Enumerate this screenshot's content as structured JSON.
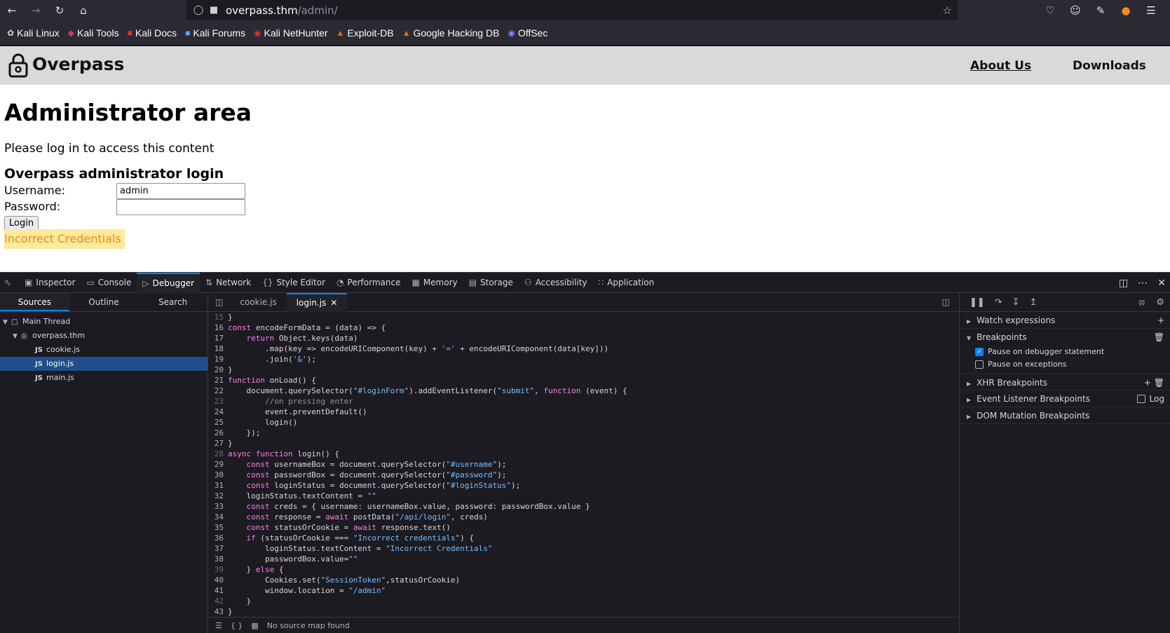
{
  "browser": {
    "url_host": "overpass.thm",
    "url_path": "/admin/"
  },
  "bookmarks": [
    "Kali Linux",
    "Kali Tools",
    "Kali Docs",
    "Kali Forums",
    "Kali NetHunter",
    "Exploit-DB",
    "Google Hacking DB",
    "OffSec"
  ],
  "site": {
    "name": "Overpass",
    "nav": {
      "about": "About Us",
      "downloads": "Downloads"
    },
    "title": "Administrator area",
    "description": "Please log in to access this content",
    "login_heading": "Overpass administrator login",
    "username_label": "Username:",
    "password_label": "Password:",
    "username_value": "admin",
    "password_value": "",
    "login_button": "Login",
    "status": "Incorrect Credentials"
  },
  "devtools": {
    "tabs": [
      "Inspector",
      "Console",
      "Debugger",
      "Network",
      "Style Editor",
      "Performance",
      "Memory",
      "Storage",
      "Accessibility",
      "Application"
    ],
    "active_tab": "Debugger",
    "source_tabs": [
      "Sources",
      "Outline",
      "Search"
    ],
    "tree": {
      "thread": "Main Thread",
      "host": "overpass.thm",
      "files": [
        "cookie.js",
        "login.js",
        "main.js"
      ],
      "selected": "login.js"
    },
    "editor_tabs": [
      "cookie.js",
      "login.js"
    ],
    "code_lines": [
      {
        "n": "15",
        "t": "}"
      },
      {
        "n": "16",
        "t": "const encodeFormData = (data) => {"
      },
      {
        "n": "17",
        "t": "    return Object.keys(data)"
      },
      {
        "n": "18",
        "t": "        .map(key => encodeURIComponent(key) + '=' + encodeURIComponent(data[key]))"
      },
      {
        "n": "19",
        "t": "        .join('&');"
      },
      {
        "n": "20",
        "t": "}"
      },
      {
        "n": "21",
        "t": "function onLoad() {"
      },
      {
        "n": "22",
        "t": "    document.querySelector(\"#loginForm\").addEventListener(\"submit\", function (event) {"
      },
      {
        "n": "23",
        "t": "        //on pressing enter"
      },
      {
        "n": "24",
        "t": "        event.preventDefault()"
      },
      {
        "n": "25",
        "t": "        login()"
      },
      {
        "n": "26",
        "t": "    });"
      },
      {
        "n": "27",
        "t": "}"
      },
      {
        "n": "28",
        "t": "async function login() {"
      },
      {
        "n": "29",
        "t": "    const usernameBox = document.querySelector(\"#username\");"
      },
      {
        "n": "30",
        "t": "    const passwordBox = document.querySelector(\"#password\");"
      },
      {
        "n": "31",
        "t": "    const loginStatus = document.querySelector(\"#loginStatus\");"
      },
      {
        "n": "32",
        "t": "    loginStatus.textContent = \"\""
      },
      {
        "n": "33",
        "t": "    const creds = { username: usernameBox.value, password: passwordBox.value }"
      },
      {
        "n": "34",
        "t": "    const response = await postData(\"/api/login\", creds)"
      },
      {
        "n": "35",
        "t": "    const statusOrCookie = await response.text()"
      },
      {
        "n": "36",
        "t": "    if (statusOrCookie === \"Incorrect credentials\") {"
      },
      {
        "n": "37",
        "t": "        loginStatus.textContent = \"Incorrect Credentials\""
      },
      {
        "n": "38",
        "t": "        passwordBox.value=\"\""
      },
      {
        "n": "39",
        "t": "    } else {"
      },
      {
        "n": "40",
        "t": "        Cookies.set(\"SessionToken\",statusOrCookie)"
      },
      {
        "n": "41",
        "t": "        window.location = \"/admin\""
      },
      {
        "n": "42",
        "t": "    }"
      },
      {
        "n": "43",
        "t": "}"
      }
    ],
    "muted_lines": [
      "15",
      "23",
      "28",
      "39",
      "42"
    ],
    "status_text": "No source map found",
    "side_panel": {
      "watch": "Watch expressions",
      "breakpoints": "Breakpoints",
      "pause_debugger": "Pause on debugger statement",
      "pause_exceptions": "Pause on exceptions",
      "xhr": "XHR Breakpoints",
      "event_listener": "Event Listener Breakpoints",
      "log": "Log",
      "dom_mutation": "DOM Mutation Breakpoints"
    }
  }
}
